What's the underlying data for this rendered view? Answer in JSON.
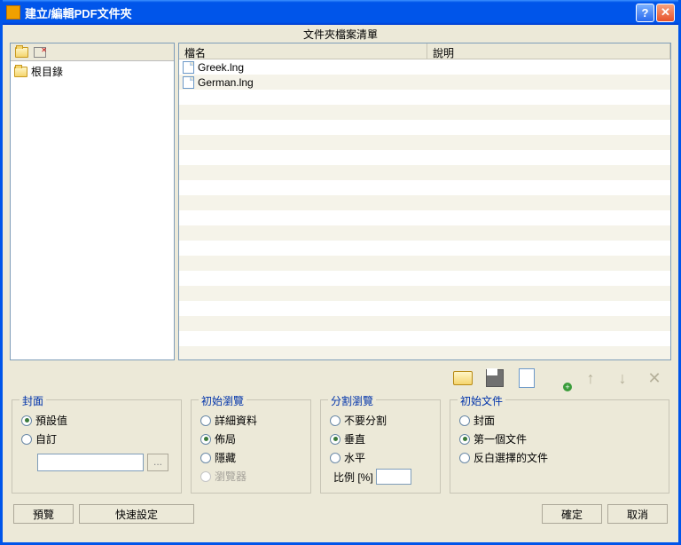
{
  "title": "建立/編輯PDF文件夾",
  "list_header": "文件夾檔案清單",
  "tree": {
    "root": "根目錄"
  },
  "columns": {
    "name": "檔名",
    "desc": "說明"
  },
  "files": [
    {
      "name": "Greek.lng"
    },
    {
      "name": "German.lng"
    }
  ],
  "groups": {
    "cover": {
      "legend": "封面",
      "preset": "預設值",
      "custom": "自訂"
    },
    "initview": {
      "legend": "初始瀏覽",
      "detail": "詳細資料",
      "layout": "佈局",
      "hidden": "隱藏",
      "browser": "瀏覽器"
    },
    "split": {
      "legend": "分割瀏覽",
      "nosplit": "不要分割",
      "vertical": "垂直",
      "horizontal": "水平",
      "ratio_label": "比例 [%]"
    },
    "initdoc": {
      "legend": "初始文件",
      "cover": "封面",
      "first": "第一個文件",
      "selected": "反白選擇的文件"
    }
  },
  "buttons": {
    "preview": "預覽",
    "quickset": "快速設定",
    "ok": "確定",
    "cancel": "取消",
    "browse": "..."
  }
}
